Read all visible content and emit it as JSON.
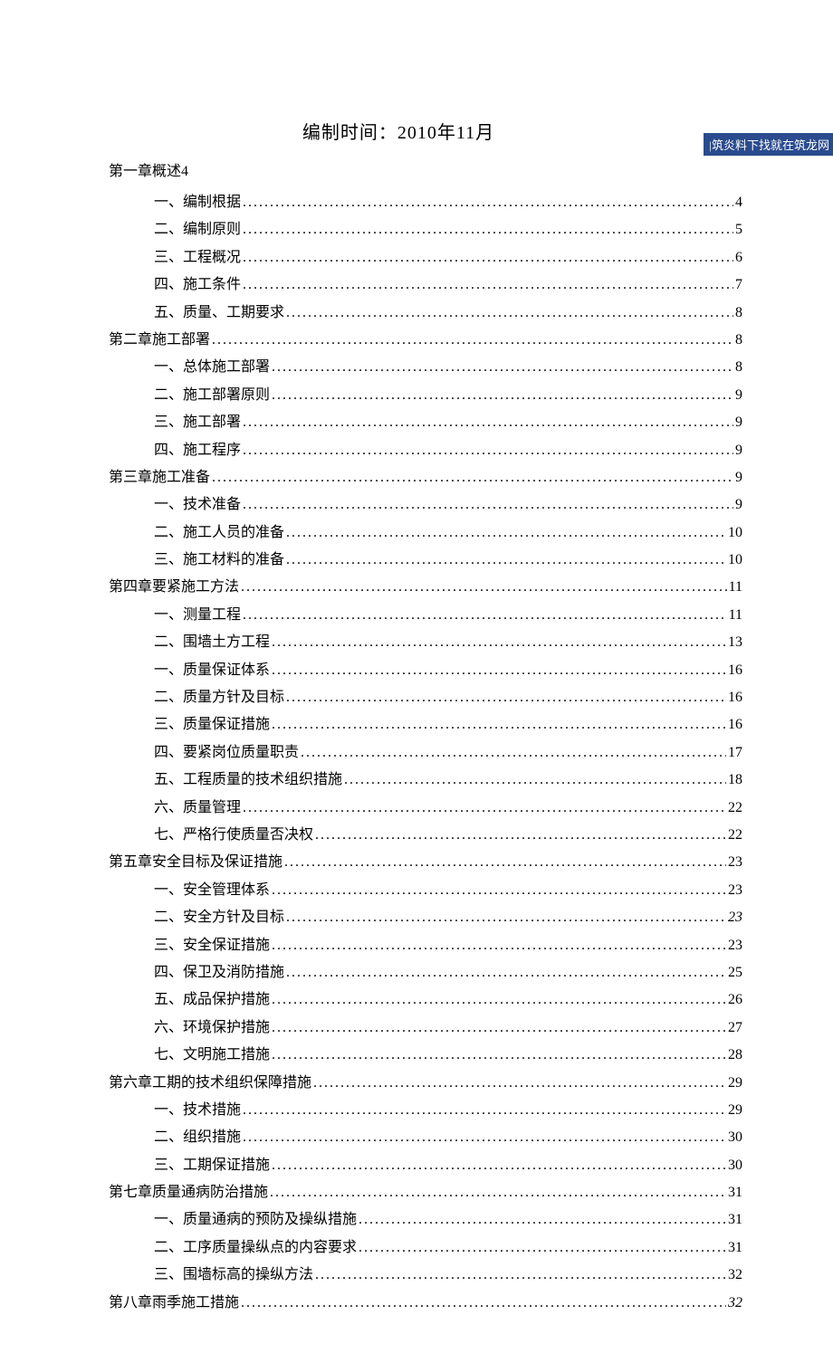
{
  "title": "编制时间：2010年11月",
  "watermark": "|筑炎料下找就在筑龙网",
  "first_chapter": "第一章概述4",
  "toc": [
    {
      "lvl": "sub",
      "label": "一、编制根据",
      "page": "4"
    },
    {
      "lvl": "sub",
      "label": "二、编制原则",
      "page": "5"
    },
    {
      "lvl": "sub",
      "label": "三、工程概况",
      "page": "6"
    },
    {
      "lvl": "sub",
      "label": "四、施工条件",
      "page": "7"
    },
    {
      "lvl": "sub",
      "label": "五、质量、工期要求",
      "page": "8"
    },
    {
      "lvl": "ch",
      "label": "第二章施工部署",
      "page": "8"
    },
    {
      "lvl": "sub",
      "label": "一、总体施工部署",
      "page": "8"
    },
    {
      "lvl": "sub",
      "label": "二、施工部署原则",
      "page": "9"
    },
    {
      "lvl": "sub",
      "label": "三、施工部署",
      "page": "9"
    },
    {
      "lvl": "sub",
      "label": "四、施工程序",
      "page": "9"
    },
    {
      "lvl": "ch",
      "label": "第三章施工准备",
      "page": "9"
    },
    {
      "lvl": "sub",
      "label": "一、技术准备",
      "page": "9"
    },
    {
      "lvl": "sub",
      "label": "二、施工人员的准备",
      "page": "10"
    },
    {
      "lvl": "sub",
      "label": "三、施工材料的准备",
      "page": "10"
    },
    {
      "lvl": "ch",
      "label": "第四章要紧施工方法",
      "page": "11"
    },
    {
      "lvl": "sub",
      "label": "一、测量工程",
      "page": "11"
    },
    {
      "lvl": "sub",
      "label": "二、围墙土方工程",
      "page": "13"
    },
    {
      "lvl": "sub",
      "label": "一、质量保证体系",
      "page": "16"
    },
    {
      "lvl": "sub",
      "label": "二、质量方针及目标",
      "page": "16"
    },
    {
      "lvl": "sub",
      "label": "三、质量保证措施",
      "page": "16"
    },
    {
      "lvl": "sub",
      "label": "四、要紧岗位质量职责",
      "page": "17"
    },
    {
      "lvl": "sub",
      "label": "五、工程质量的技术组织措施",
      "page": "18"
    },
    {
      "lvl": "sub",
      "label": "六、质量管理",
      "page": "22"
    },
    {
      "lvl": "sub",
      "label": "七、严格行使质量否决权",
      "page": "22"
    },
    {
      "lvl": "ch",
      "label": "第五章安全目标及保证措施",
      "page": "23"
    },
    {
      "lvl": "sub",
      "label": "一、安全管理体系",
      "page": "23"
    },
    {
      "lvl": "sub",
      "label": "二、安全方针及目标",
      "page": "23",
      "italic": true
    },
    {
      "lvl": "sub",
      "label": "三、安全保证措施",
      "page": "23"
    },
    {
      "lvl": "sub",
      "label": "四、保卫及消防措施",
      "page": "25"
    },
    {
      "lvl": "sub",
      "label": "五、成品保护措施",
      "page": "26"
    },
    {
      "lvl": "sub",
      "label": "六、环境保护措施",
      "page": "27"
    },
    {
      "lvl": "sub",
      "label": "七、文明施工措施",
      "page": "28"
    },
    {
      "lvl": "ch",
      "label": "第六章工期的技术组织保障措施",
      "page": "29"
    },
    {
      "lvl": "sub",
      "label": "一、技术措施",
      "page": "29"
    },
    {
      "lvl": "sub",
      "label": "二、组织措施",
      "page": "30"
    },
    {
      "lvl": "sub",
      "label": "三、工期保证措施",
      "page": "30"
    },
    {
      "lvl": "ch",
      "label": "第七章质量通病防治措施",
      "page": "31"
    },
    {
      "lvl": "sub",
      "label": "一、质量通病的预防及操纵措施",
      "page": "31"
    },
    {
      "lvl": "sub",
      "label": "二、工序质量操纵点的内容要求",
      "page": "31"
    },
    {
      "lvl": "sub",
      "label": "三、围墙标高的操纵方法",
      "page": "32"
    },
    {
      "lvl": "ch",
      "label": "第八章雨季施工措施",
      "page": "32",
      "italic": true
    }
  ]
}
